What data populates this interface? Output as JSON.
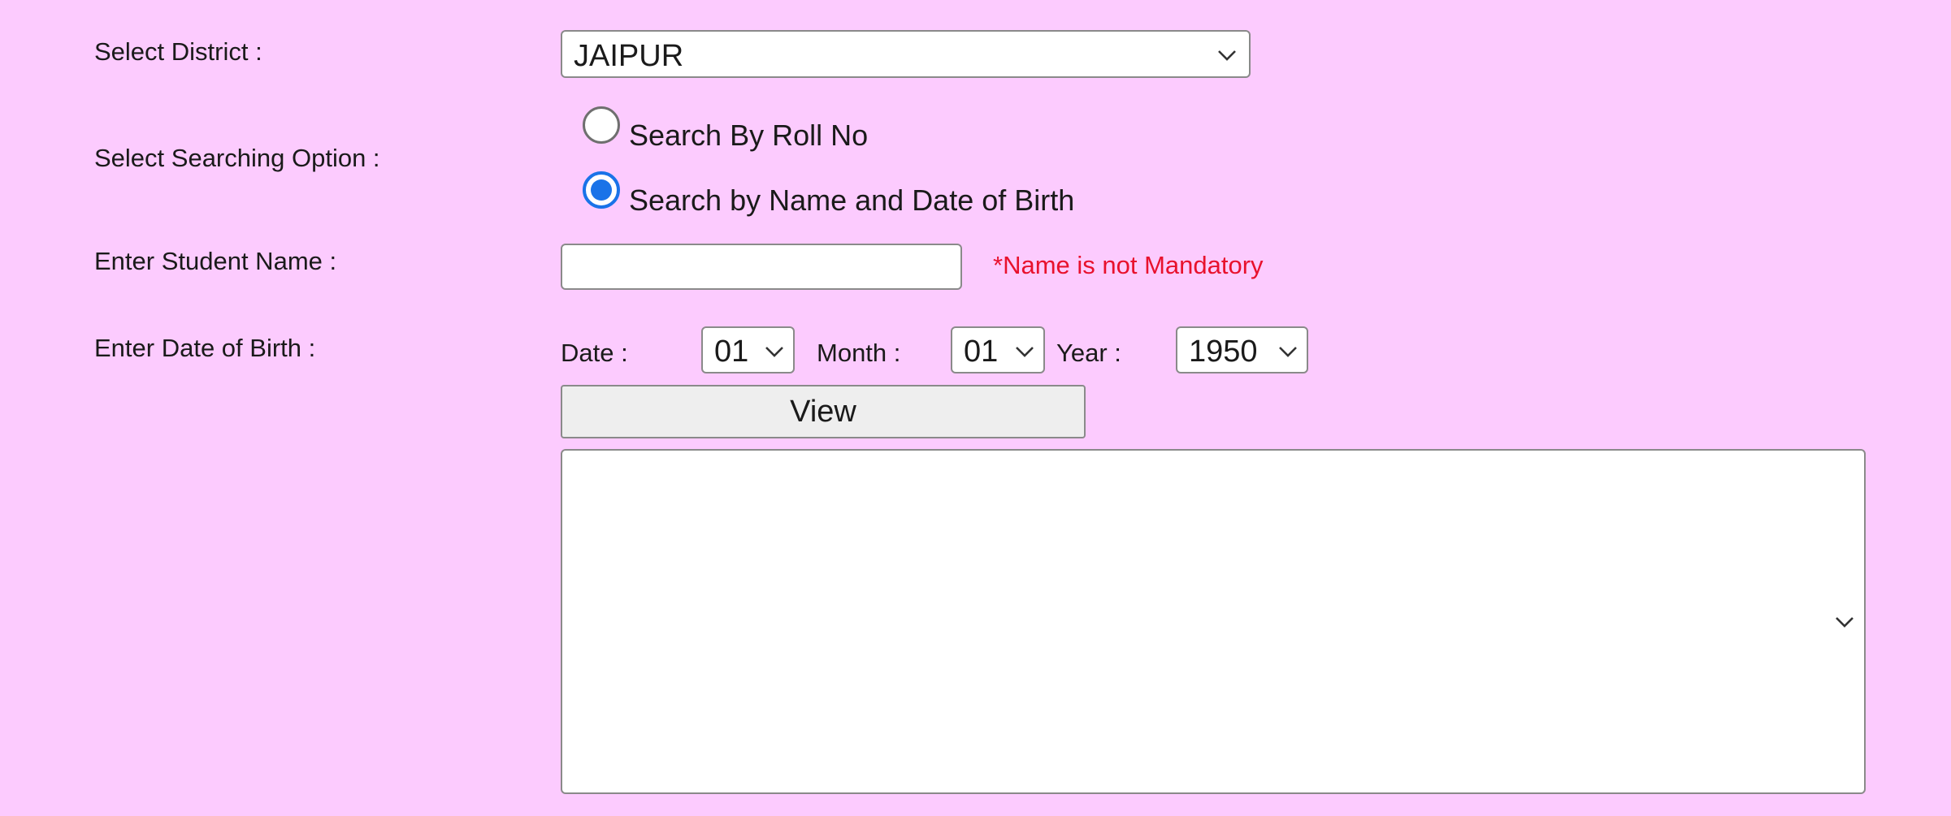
{
  "form": {
    "district": {
      "label": "Select District :",
      "selected": "JAIPUR"
    },
    "search_option": {
      "label": "Select Searching Option :",
      "options": [
        {
          "label": "Search By Roll No",
          "checked": false
        },
        {
          "label": "Search by Name and Date of Birth",
          "checked": true
        }
      ]
    },
    "student_name": {
      "label": "Enter Student Name :",
      "value": "",
      "note": "*Name is not Mandatory"
    },
    "dob": {
      "label": "Enter Date of Birth :",
      "date_label": "Date :",
      "date_value": "01",
      "month_label": "Month :",
      "month_value": "01",
      "year_label": "Year :",
      "year_value": "1950"
    },
    "view_button": "View",
    "results_select": {
      "selected": ""
    }
  },
  "colors": {
    "background": "#fccbfe",
    "error_text": "#e8112d",
    "radio_accent": "#1a73e8"
  }
}
